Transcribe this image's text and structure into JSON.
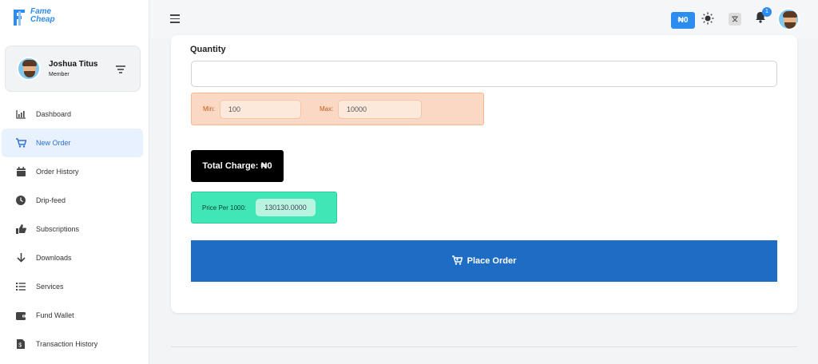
{
  "brand": {
    "line1": "Fame",
    "line2": "Cheap",
    "color": "#2d8cf0"
  },
  "profile": {
    "name": "Joshua Titus",
    "role": "Member"
  },
  "nav": [
    {
      "label": "Dashboard",
      "icon": "bar-chart-icon",
      "active": false
    },
    {
      "label": "New Order",
      "icon": "cart-icon",
      "active": true
    },
    {
      "label": "Order History",
      "icon": "calendar-icon",
      "active": false
    },
    {
      "label": "Drip-feed",
      "icon": "clock-icon",
      "active": false
    },
    {
      "label": "Subscriptions",
      "icon": "thumbs-up-icon",
      "active": false
    },
    {
      "label": "Downloads",
      "icon": "arrow-down-icon",
      "active": false
    },
    {
      "label": "Services",
      "icon": "list-icon",
      "active": false
    },
    {
      "label": "Fund Wallet",
      "icon": "wallet-icon",
      "active": false
    },
    {
      "label": "Transaction History",
      "icon": "receipt-icon",
      "active": false
    }
  ],
  "topbar": {
    "balance": "₦0",
    "notifications": "1"
  },
  "form": {
    "quantity_label": "Quantity",
    "quantity_value": "",
    "min_label": "Min:",
    "min_value": "100",
    "max_label": "Max:",
    "max_value": "10000",
    "total_charge": "Total Charge: ₦0",
    "price_label": "Price Per 1000:",
    "price_value": "130130.0000",
    "place_order": "Place Order"
  },
  "colors": {
    "accent": "#2d8cf0",
    "place_order": "#1f6cc4",
    "minmax_bg": "#fbd8c3",
    "price_bg": "#41e6b6",
    "total_bg": "#000000"
  }
}
